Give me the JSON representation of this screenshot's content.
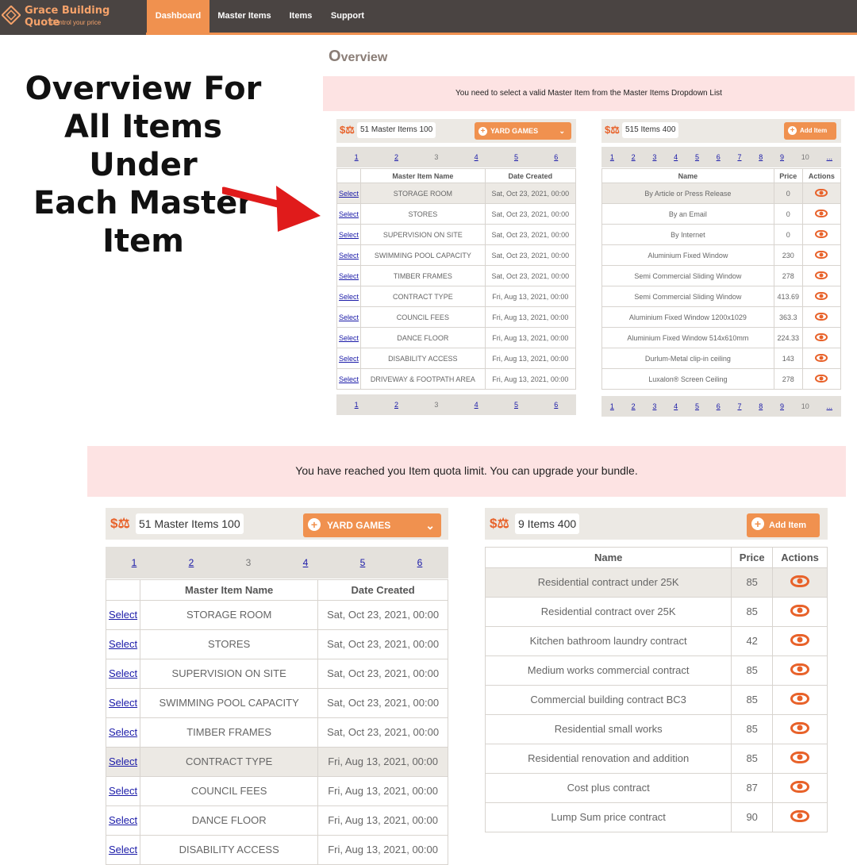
{
  "nav": {
    "brand": "Grace Building Quote",
    "tagline": "Control your price",
    "items": [
      {
        "label": "Dashboard",
        "active": true
      },
      {
        "label": "Master Items",
        "active": false
      },
      {
        "label": "Items",
        "active": false
      },
      {
        "label": "Support",
        "active": false
      }
    ]
  },
  "headline": [
    "Overview For",
    "All Items  Under",
    "Each Master",
    "Item"
  ],
  "overview": {
    "title_first": "O",
    "title_rest": "verview",
    "alert": "You need to select a valid Master Item from the Master Items Dropdown List",
    "master_panel": {
      "count": "51 Master Items 100",
      "dropdown": "YARD GAMES",
      "pages": [
        "1",
        "2",
        "3",
        "4",
        "5",
        "6"
      ],
      "current_page": "3",
      "columns": [
        "",
        "Master Item Name",
        "Date Created"
      ],
      "select_label": "Select",
      "rows": [
        {
          "name": "STORAGE ROOM",
          "date": "Sat, Oct 23, 2021, 00:00"
        },
        {
          "name": "STORES",
          "date": "Sat, Oct 23, 2021, 00:00"
        },
        {
          "name": "SUPERVISION ON SITE",
          "date": "Sat, Oct 23, 2021, 00:00"
        },
        {
          "name": "SWIMMING POOL CAPACITY",
          "date": "Sat, Oct 23, 2021, 00:00"
        },
        {
          "name": "TIMBER FRAMES",
          "date": "Sat, Oct 23, 2021, 00:00"
        },
        {
          "name": "CONTRACT TYPE",
          "date": "Fri, Aug 13, 2021, 00:00"
        },
        {
          "name": "COUNCIL FEES",
          "date": "Fri, Aug 13, 2021, 00:00"
        },
        {
          "name": "DANCE FLOOR",
          "date": "Fri, Aug 13, 2021, 00:00"
        },
        {
          "name": "DISABILITY ACCESS",
          "date": "Fri, Aug 13, 2021, 00:00"
        },
        {
          "name": "DRIVEWAY & FOOTPATH AREA",
          "date": "Fri, Aug 13, 2021, 00:00"
        }
      ]
    },
    "items_panel": {
      "count": "515 Items 400",
      "add_label": "Add Item",
      "pages": [
        "1",
        "2",
        "3",
        "4",
        "5",
        "6",
        "7",
        "8",
        "9",
        "10",
        "..."
      ],
      "current_page": "10",
      "columns": [
        "Name",
        "Price",
        "Actions"
      ],
      "rows": [
        {
          "name": "By Article or Press Release",
          "price": "0"
        },
        {
          "name": "By an Email",
          "price": "0"
        },
        {
          "name": "By Internet",
          "price": "0"
        },
        {
          "name": "Aluminium Fixed Window",
          "price": "230"
        },
        {
          "name": "Semi Commercial Sliding Window",
          "price": "278"
        },
        {
          "name": "Semi Commercial Sliding Window",
          "price": "413.69"
        },
        {
          "name": "Aluminium Fixed Window 1200x1029",
          "price": "363.3"
        },
        {
          "name": "Aluminium Fixed Window 514x610mm",
          "price": "224.33"
        },
        {
          "name": "Durlum-Metal clip-in ceiling",
          "price": "143"
        },
        {
          "name": "Luxalon® Screen Ceiling",
          "price": "278"
        }
      ]
    }
  },
  "quota": {
    "alert": "You have reached you Item quota limit. You can upgrade your bundle.",
    "master_panel": {
      "count": "51 Master Items 100",
      "dropdown": "YARD GAMES",
      "pages": [
        "1",
        "2",
        "3",
        "4",
        "5",
        "6"
      ],
      "current_page": "3",
      "columns": [
        "",
        "Master Item Name",
        "Date Created"
      ],
      "select_label": "Select",
      "rows": [
        {
          "name": "STORAGE ROOM",
          "date": "Sat, Oct 23, 2021, 00:00"
        },
        {
          "name": "STORES",
          "date": "Sat, Oct 23, 2021, 00:00"
        },
        {
          "name": "SUPERVISION ON SITE",
          "date": "Sat, Oct 23, 2021, 00:00"
        },
        {
          "name": "SWIMMING POOL CAPACITY",
          "date": "Sat, Oct 23, 2021, 00:00"
        },
        {
          "name": "TIMBER FRAMES",
          "date": "Sat, Oct 23, 2021, 00:00"
        },
        {
          "name": "CONTRACT TYPE",
          "date": "Fri, Aug 13, 2021, 00:00"
        },
        {
          "name": "COUNCIL FEES",
          "date": "Fri, Aug 13, 2021, 00:00"
        },
        {
          "name": "DANCE FLOOR",
          "date": "Fri, Aug 13, 2021, 00:00"
        },
        {
          "name": "DISABILITY ACCESS",
          "date": "Fri, Aug 13, 2021, 00:00"
        }
      ]
    },
    "items_panel": {
      "count": "9 Items 400",
      "add_label": "Add Item",
      "columns": [
        "Name",
        "Price",
        "Actions"
      ],
      "rows": [
        {
          "name": "Residential contract under 25K",
          "price": "85"
        },
        {
          "name": "Residential contract over 25K",
          "price": "85"
        },
        {
          "name": "Kitchen bathroom laundry contract",
          "price": "42"
        },
        {
          "name": "Medium works commercial contract",
          "price": "85"
        },
        {
          "name": "Commercial building contract BC3",
          "price": "85"
        },
        {
          "name": "Residential small works",
          "price": "85"
        },
        {
          "name": "Residential renovation and addition",
          "price": "85"
        },
        {
          "name": "Cost plus contract",
          "price": "87"
        },
        {
          "name": "Lump Sum price contract",
          "price": "90"
        }
      ]
    }
  },
  "colors": {
    "accent": "#f0914f",
    "nav_bg": "#4a4442",
    "alert_bg": "#fde3e3",
    "link": "#1a1aa8"
  }
}
